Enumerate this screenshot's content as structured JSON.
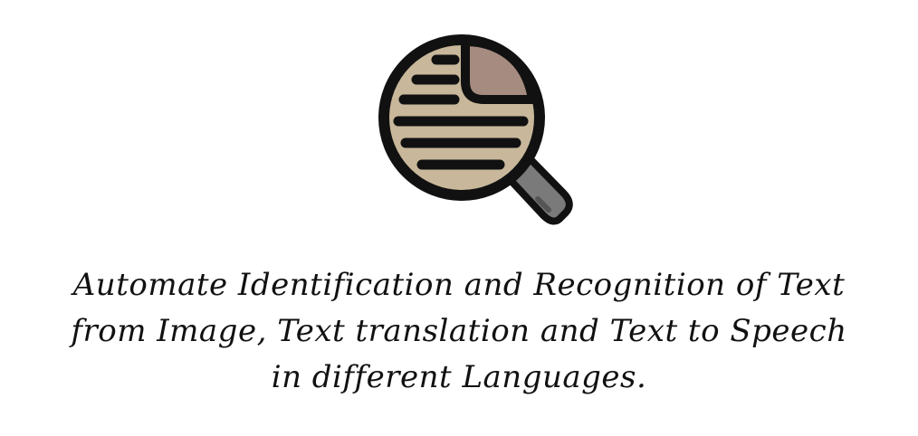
{
  "icon": "magnifier-document-icon",
  "colors": {
    "background": "#ffffff",
    "lens_fill": "#c8b79a",
    "page_corner": "#a68b80",
    "handle": "#7a7a7a",
    "outline": "#111111"
  },
  "tagline": {
    "line1": "Automate Identification and Recognition of Text",
    "line2": "from Image, Text translation and Text to Speech",
    "line3": "in different Languages."
  }
}
